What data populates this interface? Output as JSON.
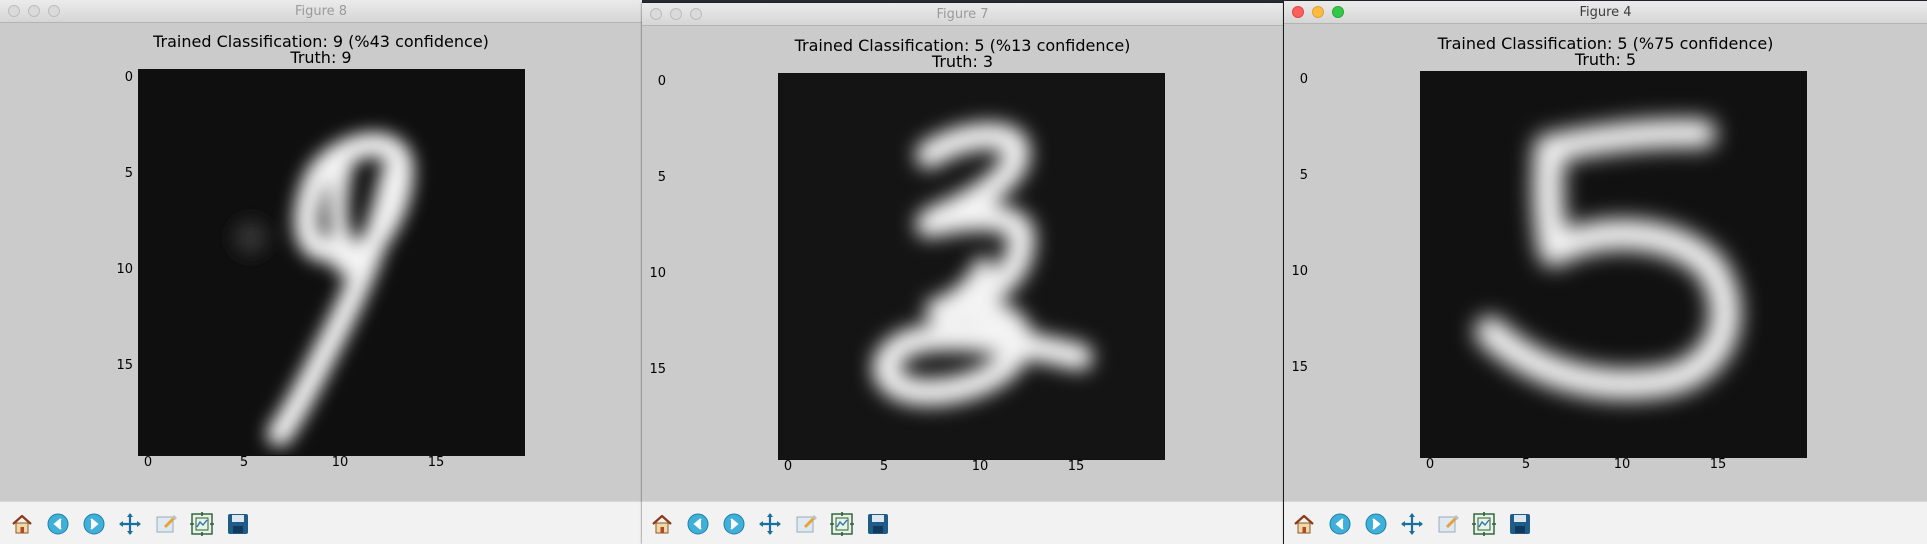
{
  "windows": [
    {
      "id": "fig8",
      "window_title": "Figure 8",
      "active": false,
      "plot_title_line1": "Trained Classification: 9 (%43 confidence)",
      "plot_title_line2": "Truth: 9",
      "digit": "9"
    },
    {
      "id": "fig7",
      "window_title": "Figure 7",
      "active": false,
      "plot_title_line1": "Trained Classification: 5 (%13 confidence)",
      "plot_title_line2": "Truth: 3",
      "digit": "3"
    },
    {
      "id": "fig4",
      "window_title": "Figure 4",
      "active": true,
      "plot_title_line1": "Trained Classification: 5 (%75 confidence)",
      "plot_title_line2": "Truth: 5",
      "digit": "5"
    }
  ],
  "axis": {
    "y_ticks": [
      "0",
      "5",
      "10",
      "15"
    ],
    "x_ticks": [
      "0",
      "5",
      "10",
      "15"
    ]
  },
  "toolbar": {
    "buttons": [
      "home-icon",
      "back-arrow-icon",
      "forward-arrow-icon",
      "pan-move-icon",
      "zoom-rect-icon",
      "subplots-config-icon",
      "save-disk-icon"
    ]
  },
  "colors": {
    "window_bg": "#cbcbcb",
    "image_bg": "#0f0f0f",
    "stroke": "#f4f4f4",
    "toolbar_bg": "#f2f2f2"
  }
}
